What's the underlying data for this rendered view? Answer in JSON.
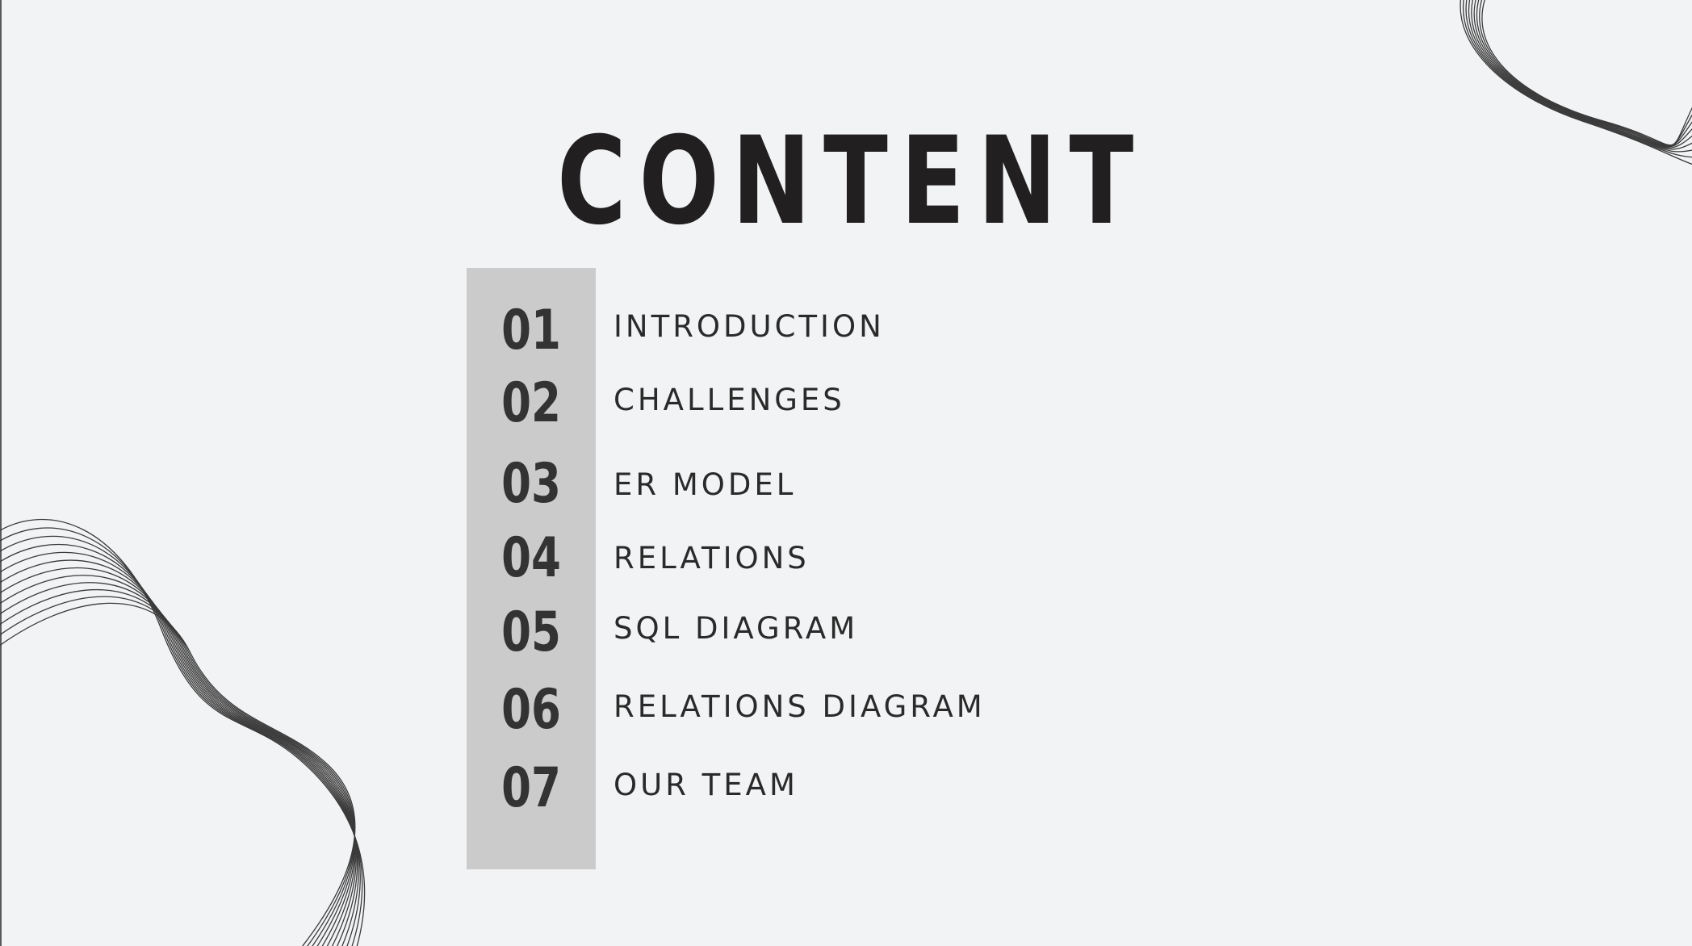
{
  "title": "CONTENT",
  "toc": [
    {
      "number": "01",
      "label": "INTRODUCTION"
    },
    {
      "number": "02",
      "label": "CHALLENGES"
    },
    {
      "number": "03",
      "label": "ER MODEL"
    },
    {
      "number": "04",
      "label": "RELATIONS"
    },
    {
      "number": "05",
      "label": "SQL DIAGRAM"
    },
    {
      "number": "06",
      "label": "RELATIONS DIAGRAM"
    },
    {
      "number": "07",
      "label": "OUR TEAM"
    }
  ],
  "colors": {
    "background": "#f2f3f5",
    "text": "#221f20",
    "number_bar": "#cbcbcb",
    "decoration_lines": "#3a3a3a"
  },
  "decorations": [
    "wavy-lines-top-right",
    "wavy-lines-bottom-left"
  ]
}
